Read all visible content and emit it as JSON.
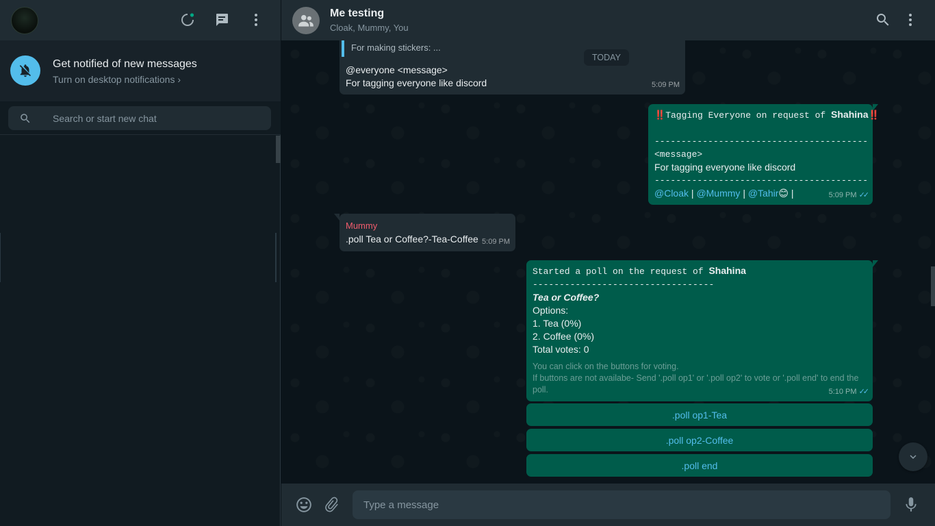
{
  "sidebar": {
    "notification": {
      "title": "Get notified of new messages",
      "subtitle": "Turn on desktop notifications ›"
    },
    "search": {
      "placeholder": "Search or start new chat"
    }
  },
  "chat": {
    "title": "Me testing",
    "members": "Cloak, Mummy, You",
    "date_divider": "TODAY",
    "messages": {
      "m1": {
        "quoted": "For making stickers: ...",
        "line1": "@everyone <message>",
        "line2": "For tagging everyone like discord",
        "time": "5:09 PM"
      },
      "m2": {
        "header_prefix": "‼️",
        "header_text": "Tagging Everyone on request of ",
        "header_name": "Shahina",
        "header_suffix": "‼️",
        "divider": "----------------------------------------------------",
        "message_tag": "<message>",
        "body": "For tagging everyone like discord",
        "mention1": "@Cloak",
        "mention2": "@Mummy",
        "mention3": "@Tahir",
        "emoji": "😊",
        "separator": "|",
        "time": "5:09 PM"
      },
      "m3": {
        "sender": "Mummy",
        "text": ".poll Tea or Coffee?-Tea-Coffee",
        "time": "5:09 PM"
      },
      "m4": {
        "header_text": "Started a poll on the request of ",
        "header_name": "Shahina",
        "divider": "----------------------------------",
        "question": "Tea or Coffee?",
        "options_label": "Options:",
        "option1": "1. Tea (0%)",
        "option2": "2. Coffee (0%)",
        "total": "Total votes: 0",
        "hint1": "You can click on the buttons for voting.",
        "hint2": "If buttons are not availabe- Send '.poll op1' or '.poll op2' to vote or '.poll end' to end the poll.",
        "time": "5:10 PM"
      }
    },
    "poll_buttons": [
      ".poll op1-Tea",
      ".poll op2-Coffee",
      ".poll end"
    ],
    "composer": {
      "placeholder": "Type a message"
    }
  },
  "colors": {
    "accent_blue": "#53bdeb",
    "outgoing_bubble": "#005c4b",
    "incoming_bubble": "#202c33",
    "sender_name": "#f15c6d"
  },
  "icons": [
    "status-icon",
    "new-chat-icon",
    "menu-icon",
    "bell-off-icon",
    "search-icon",
    "group-icon",
    "emoji-icon",
    "attach-icon",
    "mic-icon",
    "chevron-down-icon",
    "double-check-icon"
  ]
}
